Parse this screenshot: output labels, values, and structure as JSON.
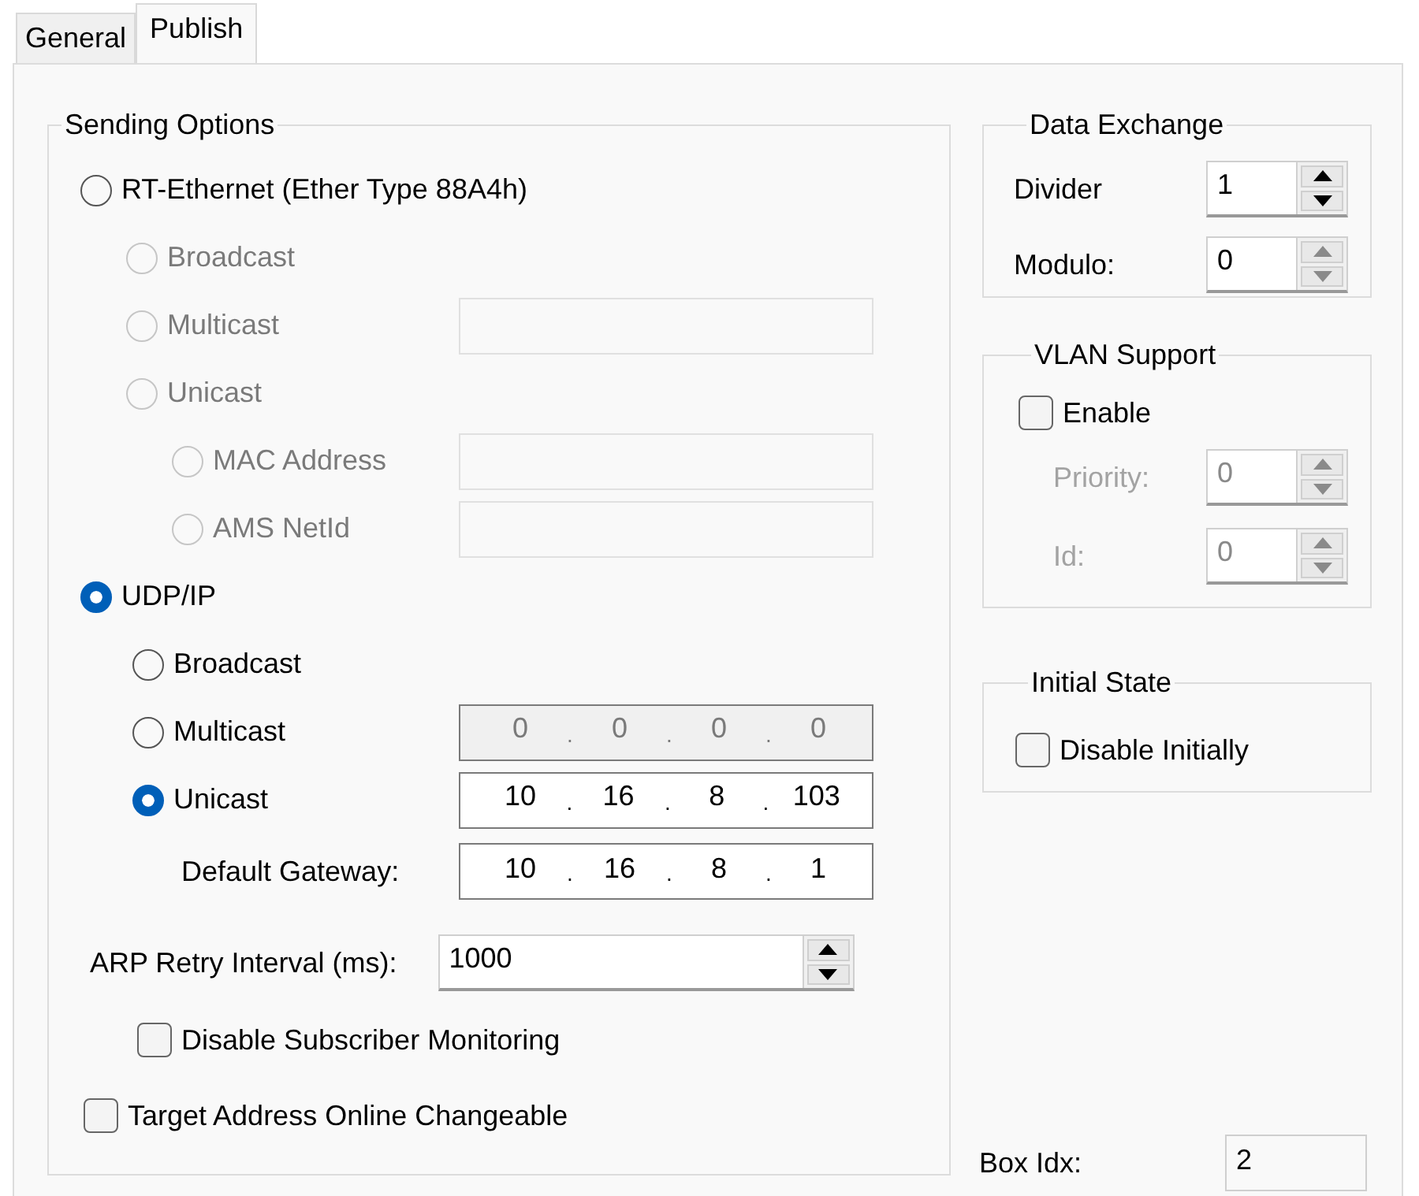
{
  "tabs": [
    {
      "label": "General",
      "selected": false
    },
    {
      "label": "Publish",
      "selected": true
    }
  ],
  "sending_options": {
    "title": "Sending Options",
    "protocols": [
      {
        "label": "RT-Ethernet (Ether Type 88A4h)",
        "selected": false,
        "disabled": false,
        "children": [
          {
            "label": "Broadcast",
            "selected": false,
            "disabled": true
          },
          {
            "label": "Multicast",
            "selected": false,
            "disabled": true,
            "field": {
              "kind": "text",
              "disabled": true
            }
          },
          {
            "label": "Unicast",
            "selected": false,
            "disabled": true,
            "children": [
              {
                "label": "MAC Address",
                "selected": false,
                "disabled": true,
                "field": {
                  "kind": "text",
                  "disabled": true
                }
              },
              {
                "label": "AMS NetId",
                "selected": false,
                "disabled": true,
                "field": {
                  "kind": "text",
                  "disabled": true
                }
              }
            ]
          }
        ]
      },
      {
        "label": "UDP/IP",
        "selected": true,
        "disabled": false,
        "children": [
          {
            "label": "Broadcast",
            "selected": false,
            "disabled": false
          },
          {
            "label": "Multicast",
            "selected": false,
            "disabled": false,
            "field": {
              "kind": "ip",
              "disabled": true,
              "octets": [
                "0",
                "0",
                "0",
                "0"
              ],
              "separator": "."
            }
          },
          {
            "label": "Unicast",
            "selected": true,
            "disabled": false,
            "field": {
              "kind": "ip",
              "disabled": false,
              "octets": [
                "10",
                "16",
                "8",
                "103"
              ],
              "separator": "."
            }
          }
        ]
      }
    ],
    "default_gateway": {
      "label": "Default Gateway:",
      "octets": [
        "10",
        "16",
        "8",
        "1"
      ],
      "separator": "."
    },
    "arp_retry": {
      "label": "ARP Retry Interval (ms):",
      "value": "1000"
    },
    "disable_subscriber_monitoring": {
      "label": "Disable Subscriber Monitoring",
      "checked": false
    },
    "target_address_online_changeable": {
      "label": "Target Address Online Changeable",
      "checked": false
    }
  },
  "data_exchange": {
    "title": "Data Exchange",
    "fields": [
      {
        "label": "Divider",
        "value": "1",
        "active": true
      },
      {
        "label": "Modulo:",
        "value": "0",
        "active": false
      }
    ]
  },
  "vlan_support": {
    "title": "VLAN Support",
    "enable": {
      "label": "Enable",
      "checked": false
    },
    "fields": [
      {
        "label": "Priority:",
        "value": "0",
        "disabled": true
      },
      {
        "label": "Id:",
        "value": "0",
        "disabled": true
      }
    ]
  },
  "initial_state": {
    "title": "Initial State",
    "checkbox": {
      "label": "Disable Initially",
      "checked": false
    }
  },
  "box_idx": {
    "label": "Box Idx:",
    "value": "2"
  }
}
